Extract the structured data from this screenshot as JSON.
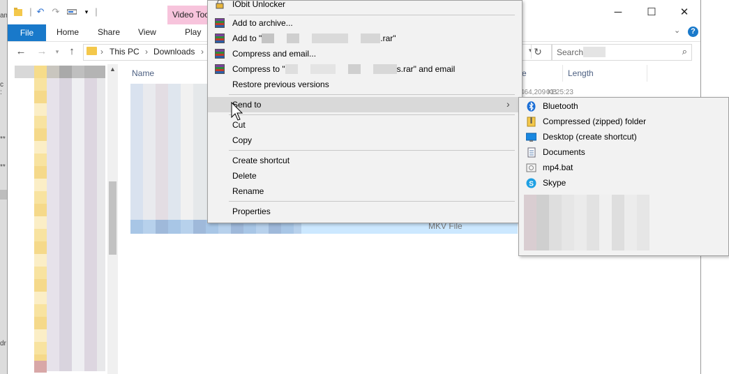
{
  "desktop": {
    "edge_fragments": [
      "am",
      "c :",
      "**",
      "**",
      "dr"
    ]
  },
  "window": {
    "ribbon_context_tab": "Video Too",
    "tabs": [
      "File",
      "Home",
      "Share",
      "View",
      "Play"
    ],
    "controls": {
      "minimize": "─",
      "maximize": "☐",
      "close": "✕"
    },
    "help": "?"
  },
  "address": {
    "crumbs": [
      "This PC",
      "Downloads"
    ],
    "separator": "›"
  },
  "search": {
    "placeholder": "Search"
  },
  "columns": {
    "name": "Name",
    "type_partial": "e",
    "length": "Length"
  },
  "file_list": {
    "partial_size": "464,209 KB",
    "partial_length": "01:25:23",
    "selected_type": "MKV File"
  },
  "context_menu": {
    "items": [
      {
        "label": "IObit Unlocker",
        "icon": "lock-icon"
      },
      {
        "label": "Add to archive...",
        "icon": "winrar-icon"
      },
      {
        "label_prefix": "Add to \"",
        "label_suffix": ".rar\"",
        "icon": "winrar-icon"
      },
      {
        "label": "Compress and email...",
        "icon": "winrar-icon"
      },
      {
        "label_prefix": "Compress to \"",
        "label_suffix": "s.rar\" and email",
        "icon": "winrar-icon"
      },
      {
        "label": "Restore previous versions"
      },
      {
        "label": "Send to",
        "submenu": true
      },
      {
        "label": "Cut"
      },
      {
        "label": "Copy"
      },
      {
        "label": "Create shortcut"
      },
      {
        "label": "Delete"
      },
      {
        "label": "Rename"
      },
      {
        "label": "Properties"
      }
    ]
  },
  "send_to": {
    "items": [
      {
        "label": "Bluetooth",
        "icon": "bluetooth-icon"
      },
      {
        "label": "Compressed (zipped) folder",
        "icon": "zip-folder-icon"
      },
      {
        "label": "Desktop (create shortcut)",
        "icon": "desktop-icon"
      },
      {
        "label": "Documents",
        "icon": "documents-icon"
      },
      {
        "label": "mp4.bat",
        "icon": "batch-file-icon"
      },
      {
        "label": "Skype",
        "icon": "skype-icon"
      }
    ]
  },
  "colors": {
    "file_tab": "#1979ca",
    "context_tab": "#f7c4dc",
    "selection": "#cce8ff",
    "menu_bg": "#f2f2f2",
    "menu_highlight": "#d9d9d9"
  }
}
